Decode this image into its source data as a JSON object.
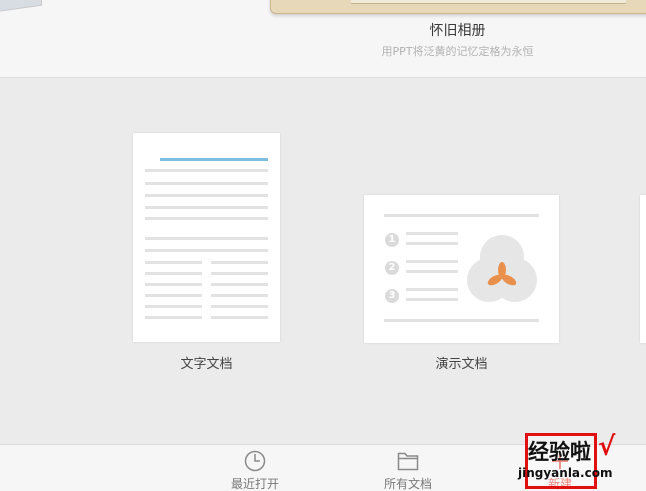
{
  "album": {
    "title": "怀旧相册",
    "subtitle": "用PPT将泛黄的记忆定格为永恒"
  },
  "cards": {
    "writer_label": "文字文档",
    "presentation_label": "演示文档",
    "presentation_numbers": [
      "1",
      "2",
      "3"
    ]
  },
  "toolbar": {
    "recent_label": "最近打开",
    "all_label": "所有文档",
    "new_label": "新建"
  },
  "watermark": {
    "brand": "经验啦",
    "check": "√",
    "url": "jingyanla.com"
  },
  "colors": {
    "accent_blue": "#7fbde3",
    "orange_petal": "#e8904c",
    "watermark_red": "#e01010"
  }
}
